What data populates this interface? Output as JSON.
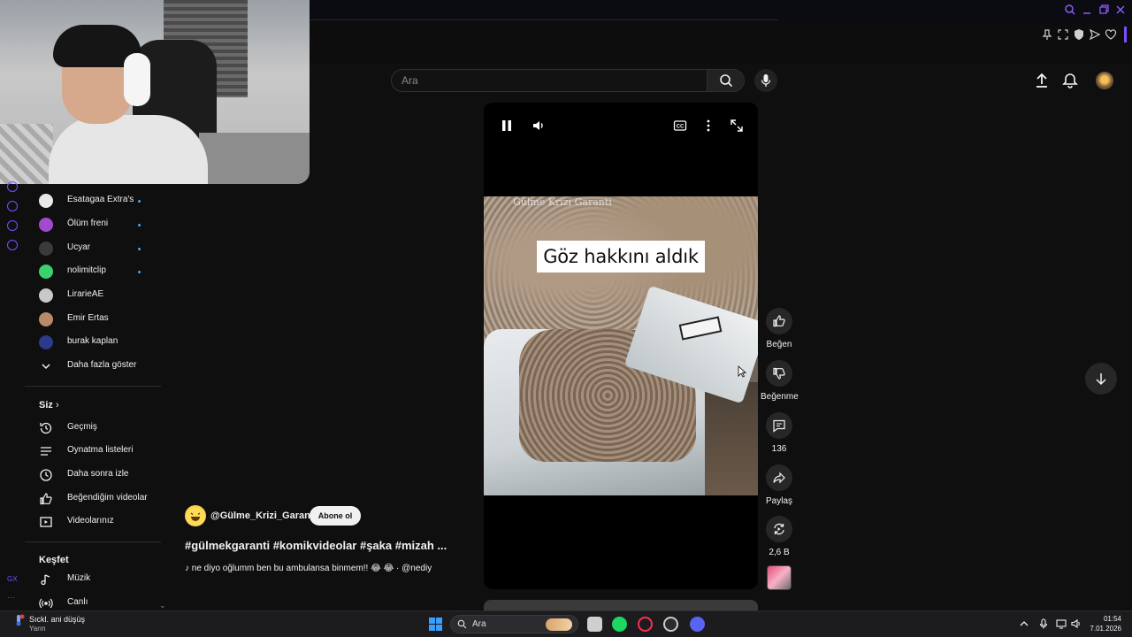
{
  "header": {
    "search_placeholder": "Ara"
  },
  "sidebar": {
    "subscriptions": [
      {
        "label": "Esatagaa Extra's",
        "avatar_color": "#e9e9e9",
        "new": true
      },
      {
        "label": "Ölüm freni",
        "avatar_color": "#a24bd1",
        "new": true
      },
      {
        "label": "Ucyar",
        "avatar_color": "#3a3a3a",
        "new": true
      },
      {
        "label": "nolimitclip",
        "avatar_color": "#3bd16f",
        "new": true
      },
      {
        "label": "LirarieAE",
        "avatar_color": "#c9c9c9",
        "new": false
      },
      {
        "label": "Emir Ertas",
        "avatar_color": "#b88a6a",
        "new": false
      },
      {
        "label": "burak kaplan",
        "avatar_color": "#2b3a8a",
        "new": false
      }
    ],
    "show_more_label": "Daha fazla göster",
    "you_heading": "Siz",
    "you_items": [
      {
        "label": "Geçmiş",
        "icon": "history-icon"
      },
      {
        "label": "Oynatma listeleri",
        "icon": "playlists-icon"
      },
      {
        "label": "Daha sonra izle",
        "icon": "watch-later-icon"
      },
      {
        "label": "Beğendiğim videolar",
        "icon": "liked-videos-icon"
      },
      {
        "label": "Videolarınız",
        "icon": "your-videos-icon"
      }
    ],
    "explore_heading": "Keşfet",
    "explore_items": [
      {
        "label": "Müzik",
        "icon": "music-icon"
      },
      {
        "label": "Canlı",
        "icon": "live-icon"
      }
    ]
  },
  "video": {
    "overlay_caption": "Göz hakkını aldık",
    "watermark": "Gülme Krizi Garanti",
    "channel_handle": "@Gülme_Krizi_Garanti",
    "subscribe_label": "Abone ol",
    "title": "#gülmekgaranti #komikvideolar #şaka #mizah ...",
    "music": "♪ ne diyo oğlumm ben bu ambulansa binmem!! 😂 😂 · @nediy"
  },
  "actions": {
    "like_label": "Beğen",
    "dislike_label": "Beğenme",
    "comments_count": "136",
    "share_label": "Paylaş",
    "remix_count": "2,6 B"
  },
  "taskbar": {
    "weather_title": "Sıckl. ani düşüş",
    "weather_sub": "Yarın",
    "search_label": "Ara",
    "time": "01:54",
    "date": "7.01.2026"
  },
  "colors": {
    "accent": "#7c4dff",
    "background": "#0f0f0f",
    "new_dot": "#3ea6ff"
  }
}
